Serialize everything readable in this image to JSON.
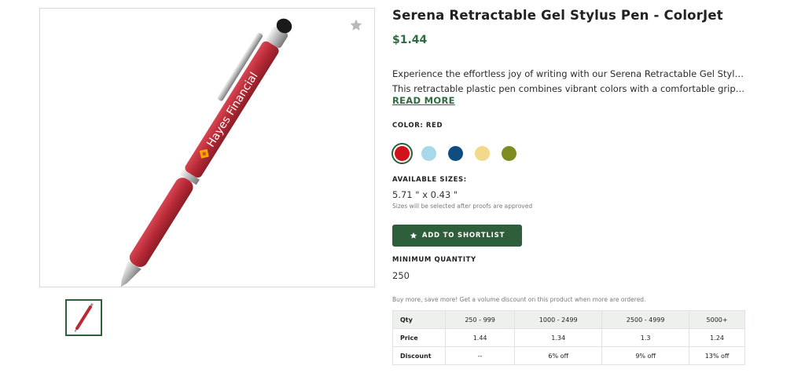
{
  "product": {
    "title": "Serena Retractable Gel Stylus Pen - ColorJet",
    "price": "$1.44",
    "description_line1": "Experience the effortless joy of writing with our Serena Retractable Gel Stylus Pen.",
    "description_line2": "This retractable plastic pen combines vibrant colors with a comfortable grip, offerin…",
    "read_more": "READ MORE",
    "imprint_text": "Hayes Financial"
  },
  "color": {
    "label": "COLOR: RED",
    "swatches": [
      {
        "name": "red",
        "hex": "#d0121b",
        "selected": true
      },
      {
        "name": "light-blue",
        "hex": "#a8d8ea",
        "selected": false
      },
      {
        "name": "navy-blue",
        "hex": "#0f4c81",
        "selected": false
      },
      {
        "name": "yellow",
        "hex": "#f3d98c",
        "selected": false
      },
      {
        "name": "olive",
        "hex": "#7d8b21",
        "selected": false
      }
    ]
  },
  "sizes": {
    "label": "AVAILABLE SIZES:",
    "value": "5.71 \" x 0.43 \"",
    "note": "Sizes will be selected after proofs are approved"
  },
  "shortlist_button": "ADD TO SHORTLIST",
  "min_quantity": {
    "label": "MINIMUM QUANTITY",
    "value": "250"
  },
  "discount_note": "Buy more, save more! Get a volume discount on this product when more are ordered.",
  "pricing_table": {
    "headers": [
      "Qty",
      "250 - 999",
      "1000 - 2499",
      "2500 - 4999",
      "5000+"
    ],
    "rows": [
      [
        "Price",
        "1.44",
        "1.34",
        "1.3",
        "1.24"
      ],
      [
        "Discount",
        "--",
        "6% off",
        "9% off",
        "13% off"
      ]
    ]
  },
  "colors": {
    "accent": "#2e5e3a",
    "price": "#2e6b3f",
    "pen_body": "#b82a35"
  }
}
